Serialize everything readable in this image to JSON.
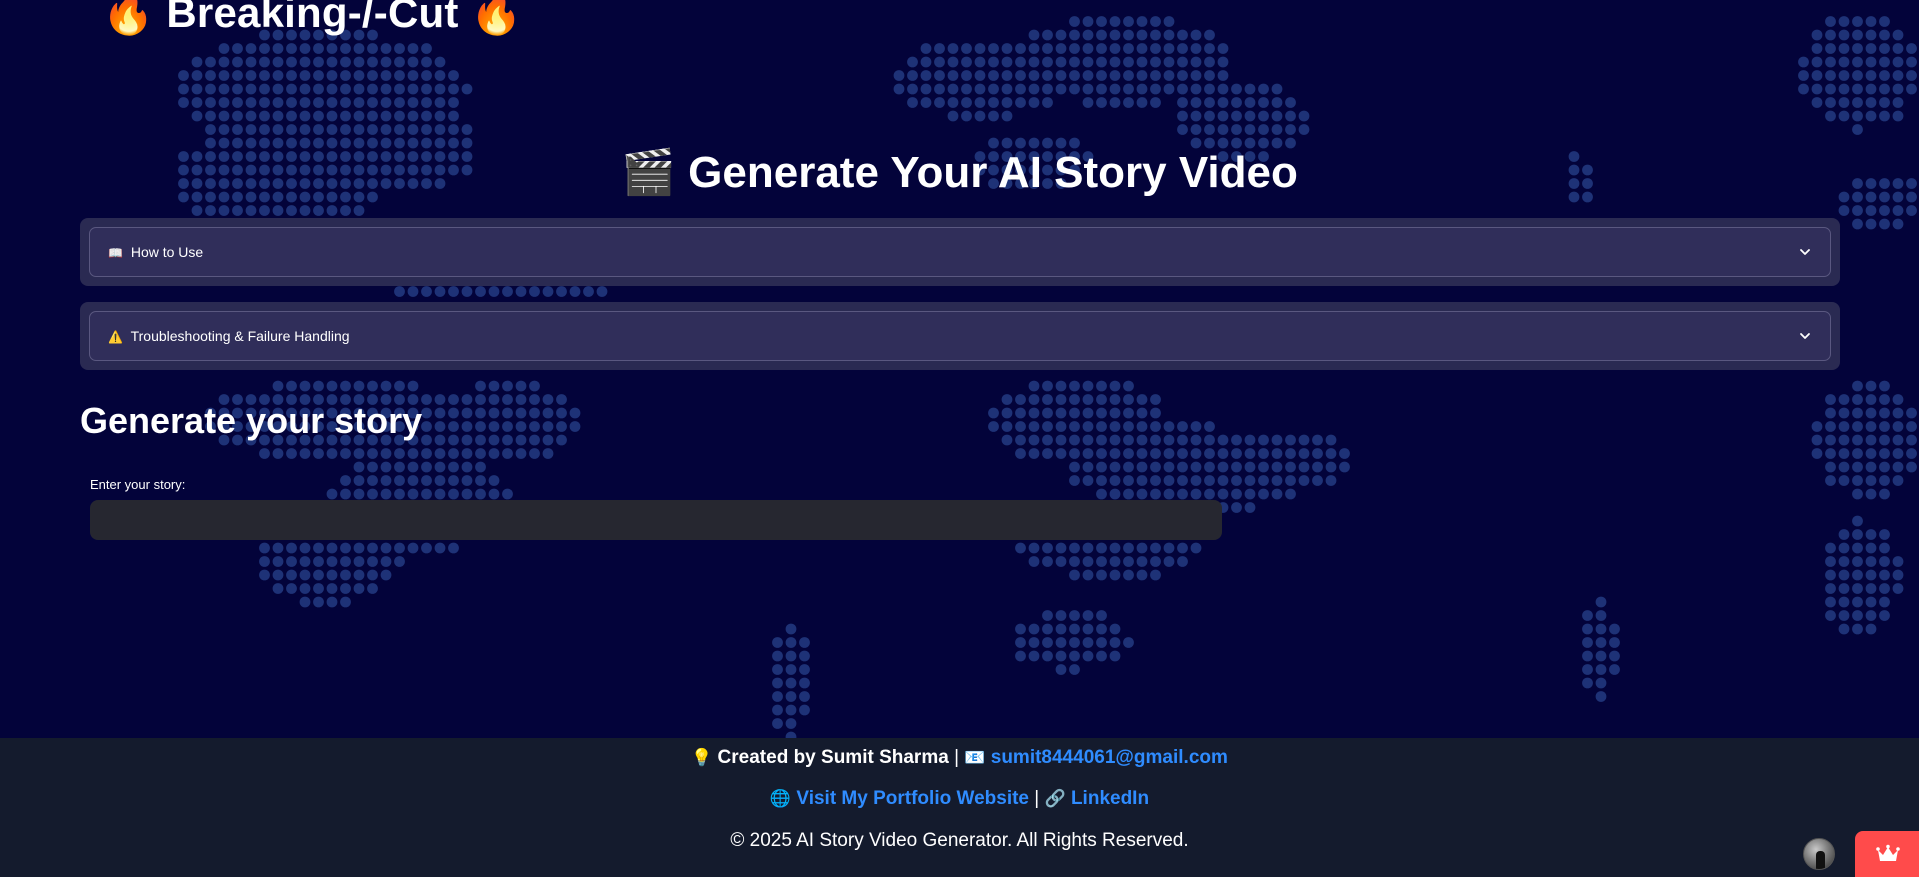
{
  "app": {
    "brand": "Breaking-/-Cut",
    "brand_icon": "fire-icon"
  },
  "page": {
    "title": "Generate Your AI Story Video",
    "title_icon": "clapperboard-icon"
  },
  "expanders": [
    {
      "icon": "book-icon",
      "icon_glyph": "📖",
      "label": "How to Use"
    },
    {
      "icon": "warning-icon",
      "icon_glyph": "⚠️",
      "label": "Troubleshooting & Failure Handling"
    }
  ],
  "story": {
    "heading": "Generate your story",
    "input_label": "Enter your story:",
    "input_value": "",
    "placeholder": ""
  },
  "footer": {
    "created_by": "Created by Sumit Sharma",
    "email": "sumit8444061@gmail.com",
    "portfolio": "Visit My Portfolio Website",
    "linkedin": "LinkedIn",
    "separator": "|",
    "copyright": "© 2025 AI Story Video Generator. All Rights Reserved."
  },
  "colors": {
    "background": "#03033a",
    "dots": "#1e3277",
    "expander": "#302e5a",
    "link": "#2f8cff",
    "footer": "#141b2d",
    "accent": "#ff4b4b"
  }
}
